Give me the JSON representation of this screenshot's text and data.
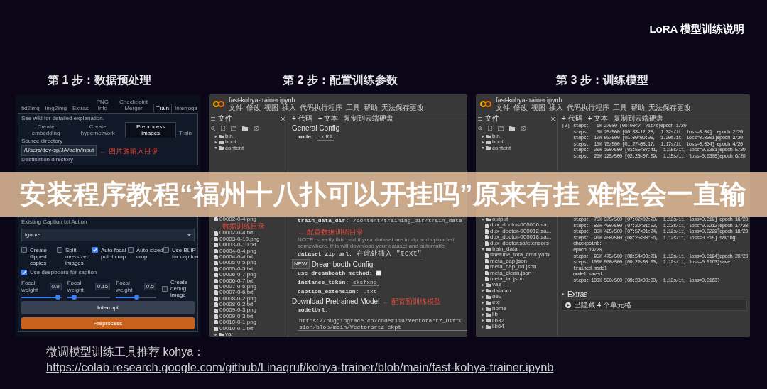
{
  "slide_title": "LoRA 模型训练说明",
  "banner": "安装程序教程“福州十八扑可以开挂吗”原来有挂 难怪会一直输",
  "steps": [
    {
      "heading": "第 1 步：数据预处理",
      "kind": "webui",
      "screen": {
        "tabs": [
          {
            "label": "txt2img",
            "selected": false
          },
          {
            "label": "img2img",
            "selected": false
          },
          {
            "label": "Extras",
            "selected": false
          },
          {
            "label": "PNG Info",
            "selected": false
          },
          {
            "label": "Checkpoint Merger",
            "selected": false
          },
          {
            "label": "Train",
            "selected": true
          },
          {
            "label": "Interroga",
            "selected": false
          }
        ],
        "hint": "See wiki for detailed explanation.",
        "subtabs": [
          {
            "label": "Create embedding",
            "selected": false
          },
          {
            "label": "Create hypernetwork",
            "selected": false
          },
          {
            "label": "Preprocess images",
            "selected": true
          },
          {
            "label": "Train",
            "selected": false
          }
        ],
        "source_label": "Source directory",
        "source_value": "/Users/dey-sp/JA/train/input",
        "source_note": "← 图片源输入目录",
        "dest_label": "Destination directory",
        "caption_action_label": "Existing Caption txt Action",
        "caption_action_value": "ignore",
        "options": [
          {
            "label": "Create flipped copies",
            "checked": false
          },
          {
            "label": "Split oversized images",
            "checked": false
          },
          {
            "label": "Auto focal point crop",
            "checked": true
          },
          {
            "label": "Auto-sized crop",
            "checked": false
          },
          {
            "label": "Use BLIP for caption",
            "checked": false
          }
        ],
        "deepbooru": {
          "label": "Use deepbooru for caption",
          "checked": true
        },
        "sliders": [
          {
            "label": "Focal weight",
            "value": "0.9",
            "level": 0.9
          },
          {
            "label": "Focal weight",
            "value": "0.15",
            "level": 0.15
          },
          {
            "label": "Focal weight",
            "value": "0.5",
            "level": 0.5
          }
        ],
        "debug": {
          "label": "Create debug image",
          "checked": false
        },
        "buttons": [
          {
            "label": "Interrupt",
            "kind": "secondary"
          },
          {
            "label": "Preprocess",
            "kind": "primary"
          }
        ]
      }
    },
    {
      "heading": "第 2 步：配置训练参数",
      "kind": "colab",
      "screen": {
        "file_name": "fast-kohya-trainer.ipynb",
        "menu": [
          "文件",
          "修改",
          "视图",
          "插入",
          "代码执行程序",
          "工具",
          "帮助"
        ],
        "save_notice": "无法保存更改",
        "sidebar_title": "文件",
        "tree_top": [
          {
            "name": "bin",
            "kind": "folder",
            "expanded": false
          },
          {
            "name": "boot",
            "kind": "folder",
            "expanded": false
          },
          {
            "name": "content",
            "kind": "folder",
            "expanded": true
          }
        ],
        "tree_bottom": [
          {
            "name": "00002-0-4.png",
            "kind": "file",
            "note": "数据训练目录"
          },
          {
            "name": "00002-0-4.txt",
            "kind": "file"
          },
          {
            "name": "00003-0-10.png",
            "kind": "file"
          },
          {
            "name": "00003-0-10.txt",
            "kind": "file"
          },
          {
            "name": "00004-0-4.png",
            "kind": "file"
          },
          {
            "name": "00004-0-4.txt",
            "kind": "file"
          },
          {
            "name": "00005-0-5.png",
            "kind": "file"
          },
          {
            "name": "00005-0-5.txt",
            "kind": "file"
          },
          {
            "name": "00006-0-7.png",
            "kind": "file"
          },
          {
            "name": "00006-0-7.txt",
            "kind": "file"
          },
          {
            "name": "00007-0-6.png",
            "kind": "file"
          },
          {
            "name": "00007-0-6.txt",
            "kind": "file"
          },
          {
            "name": "00008-0-2.png",
            "kind": "file"
          },
          {
            "name": "00008-0-2.txt",
            "kind": "file"
          },
          {
            "name": "00009-0-3.png",
            "kind": "file"
          },
          {
            "name": "00009-0-3.txt",
            "kind": "file"
          },
          {
            "name": "00010-0-1.png",
            "kind": "file"
          },
          {
            "name": "00010-0-1.txt",
            "kind": "file"
          },
          {
            "name": "var",
            "kind": "folder",
            "expanded": false
          }
        ],
        "toolbar": [
          "+ 代码",
          "+ 文本",
          "复制到云端硬盘"
        ],
        "cells_top": [
          {
            "kind": "heading",
            "text": "General Config"
          },
          {
            "kind": "field",
            "key": "mode:",
            "value": "LoRA"
          }
        ],
        "cells_bottom": [
          {
            "kind": "field",
            "key": "train_data_dir:",
            "value": "/content/training_dir/train_data",
            "note": "← 配置数据训练目录"
          },
          {
            "kind": "note",
            "text": "NOTE: specify this part if your dataset are in zip and uploaded somewhere. this will download your dataset and automatic"
          },
          {
            "kind": "field",
            "key": "dataset_zip_url:",
            "value": "在此处插入 \"text\""
          },
          {
            "kind": "heading",
            "badge": "NEW",
            "text": "Dreambooth Config"
          },
          {
            "kind": "checkbox",
            "key": "use_dreambooth_method:",
            "checked": false
          },
          {
            "kind": "field",
            "key": "instance_token:",
            "value": "sksfxng"
          },
          {
            "kind": "field",
            "key": "caption_extension:",
            "value": ".txt"
          },
          {
            "kind": "heading",
            "text": "Download Pretrained Model",
            "note": "← 配置预训练模型"
          },
          {
            "kind": "field",
            "key": "modelUrl:",
            "value": "https://huggingface.co/coder119/Vectorartz_Diffusion/blob/main/Vectorartz.ckpt"
          }
        ]
      }
    },
    {
      "heading": "第 3 步：训练模型",
      "kind": "colab",
      "screen": {
        "file_name": "fast-kohya-trainer.ipynb",
        "menu": [
          "文件",
          "修改",
          "视图",
          "插入",
          "代码执行程序",
          "工具",
          "帮助"
        ],
        "save_notice": "无法保存更改",
        "sidebar_title": "文件",
        "tree_top": [
          {
            "name": "bin",
            "kind": "folder",
            "expanded": false
          },
          {
            "name": "boot",
            "kind": "folder",
            "expanded": false
          },
          {
            "name": "content",
            "kind": "folder",
            "expanded": true
          }
        ],
        "tree_bottom": [
          {
            "name": "output",
            "kind": "folder",
            "expanded": true,
            "children": [
              {
                "name": "dux_doctor-000006.sa...",
                "kind": "file"
              },
              {
                "name": "dux_doctor-000012.sa...",
                "kind": "file"
              },
              {
                "name": "dux_doctor-000018.sa...",
                "kind": "file"
              },
              {
                "name": "dux_doctor.safetensors",
                "kind": "file"
              }
            ]
          },
          {
            "name": "train_data",
            "kind": "folder",
            "expanded": true,
            "children": [
              {
                "name": "finetune_lora_cmd.yaml",
                "kind": "file"
              },
              {
                "name": "meta_cap.json",
                "kind": "file"
              },
              {
                "name": "meta_cap_dd.json",
                "kind": "file"
              },
              {
                "name": "meta_clean.json",
                "kind": "file"
              },
              {
                "name": "meta_lat.json",
                "kind": "file"
              }
            ]
          },
          {
            "name": "vae",
            "kind": "folder",
            "expanded": false
          },
          {
            "name": "datalab",
            "kind": "folder",
            "expanded": false
          },
          {
            "name": "dev",
            "kind": "folder",
            "expanded": false
          },
          {
            "name": "etc",
            "kind": "folder",
            "expanded": false
          },
          {
            "name": "home",
            "kind": "folder",
            "expanded": false
          },
          {
            "name": "lib",
            "kind": "folder",
            "expanded": false
          },
          {
            "name": "lib32",
            "kind": "folder",
            "expanded": false
          },
          {
            "name": "lib64",
            "kind": "folder",
            "expanded": false
          }
        ],
        "toolbar": [
          "+ 代码",
          "+ 文本",
          "复制到云端硬盘"
        ],
        "cells_top": [
          {
            "kind": "log",
            "count": "[2]",
            "lines": [
              "steps:   1% 2/500 [00:00<?, ?it/s]epoch 1/20",
              "steps:   5% 25/500 [00:33<12:28,  1.32s/it, loss=0.04]  epoch 2/20",
              "steps:  10% 50/500 [01:00<09:00,  1.20s/it, loss=0.0301]epoch 3/20",
              "steps:  15% 75/500 [01:27<08:17,  1.17s/it, loss=0.034] epoch 4/20",
              "steps:  20% 100/500 [01:55<07:41,  1.15s/it, loss=0.0381]epoch 5/20",
              "steps:  25% 125/500 [02:23<07:09,  1.15s/it, loss=0.0308]epoch 6/20"
            ]
          }
        ],
        "cells_bottom": [
          {
            "kind": "log",
            "lines": [
              "steps:  75% 375/500 [07:02<02:20,  1.13s/it, loss=0.019] epoch 16/20",
              "steps:  80% 400/500 [07:29<01:52,  1.13s/it, loss=0.0212]epoch 17/20",
              "steps:  85% 425/500 [07:57<01:24,  1.12s/it, loss=0.0229]epoch 18/20",
              "steps:  90% 450/500 [08:25<00:56,  1.12s/it, loss=0.015] saving checkpoint:",
              "epoch 19/20",
              "steps:  95% 475/500 [08:54<00:28,  1.13s/it, loss=0.0194]epoch 20/20",
              "steps: 100% 500/500 [09:22<00:00,  1.12s/it, loss=0.0163]save trained model",
              "model saved.",
              "steps: 100% 500/500 [09:23<00:00,  1.13s/it, loss=0.0163]"
            ]
          },
          {
            "kind": "section",
            "text": "Extras",
            "expanded": false
          },
          {
            "kind": "hidden",
            "text": "已隐藏 4 个单元格"
          }
        ]
      }
    }
  ],
  "footer": {
    "text": "微调模型训练工具推荐 kohya：",
    "link": "https://colab.research.google.com/github/Linaqruf/kohya-trainer/blob/main/fast-kohya-trainer.ipynb"
  }
}
